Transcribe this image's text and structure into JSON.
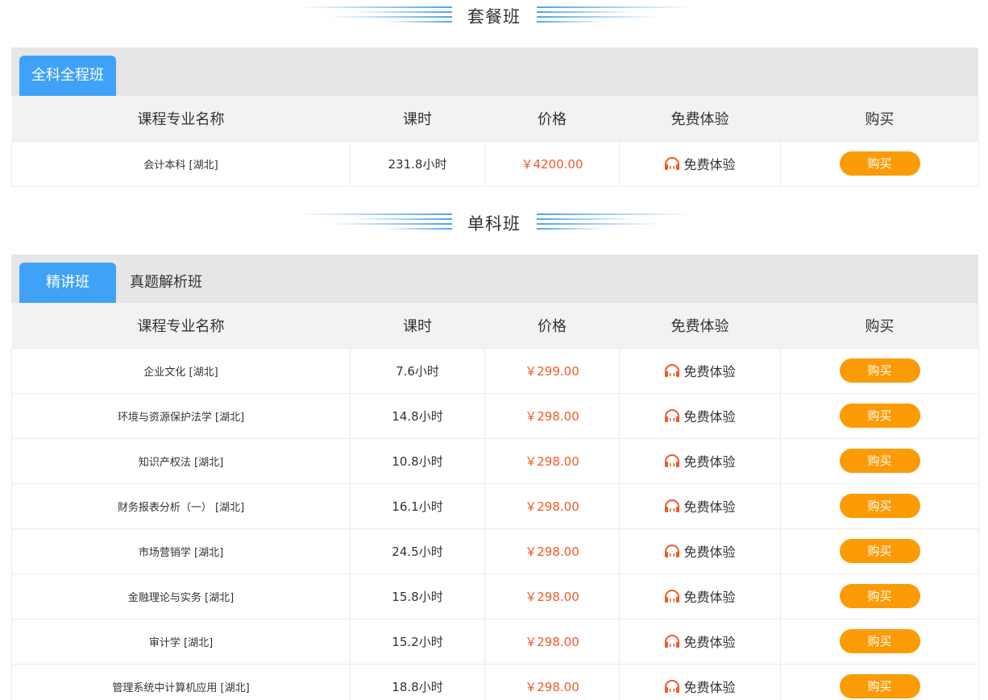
{
  "package_section": {
    "title": "套餐班",
    "tabs": [
      {
        "label": "全科全程班"
      }
    ],
    "headers": [
      "课程专业名称",
      "课时",
      "价格",
      "免费体验",
      "购买"
    ],
    "rows": [
      {
        "name": "会计本科 [湖北]",
        "hours": "231.8小时",
        "price": "￥4200.00",
        "trial": "免费体验",
        "buy": "购买"
      }
    ]
  },
  "single_section": {
    "title": "单科班",
    "tabs": [
      {
        "label": "精讲班"
      },
      {
        "label": "真题解析班"
      }
    ],
    "headers": [
      "课程专业名称",
      "课时",
      "价格",
      "免费体验",
      "购买"
    ],
    "rows": [
      {
        "name": "企业文化 [湖北]",
        "hours": "7.6小时",
        "price": "￥299.00",
        "trial": "免费体验",
        "buy": "购买"
      },
      {
        "name": "环境与资源保护法学 [湖北]",
        "hours": "14.8小时",
        "price": "￥298.00",
        "trial": "免费体验",
        "buy": "购买"
      },
      {
        "name": "知识产权法 [湖北]",
        "hours": "10.8小时",
        "price": "￥298.00",
        "trial": "免费体验",
        "buy": "购买"
      },
      {
        "name": "财务报表分析（一） [湖北]",
        "hours": "16.1小时",
        "price": "￥298.00",
        "trial": "免费体验",
        "buy": "购买"
      },
      {
        "name": "市场营销学 [湖北]",
        "hours": "24.5小时",
        "price": "￥298.00",
        "trial": "免费体验",
        "buy": "购买"
      },
      {
        "name": "金融理论与实务 [湖北]",
        "hours": "15.8小时",
        "price": "￥298.00",
        "trial": "免费体验",
        "buy": "购买"
      },
      {
        "name": "审计学 [湖北]",
        "hours": "15.2小时",
        "price": "￥298.00",
        "trial": "免费体验",
        "buy": "购买"
      },
      {
        "name": "管理系统中计算机应用 [湖北]",
        "hours": "18.8小时",
        "price": "￥298.00",
        "trial": "免费体验",
        "buy": "购买"
      }
    ]
  },
  "colors": {
    "tab_active": "#3fa2f7",
    "price": "#f05a28",
    "buy_button": "#fb9b05",
    "headphone_icon": "#f05a28"
  },
  "icons": {
    "trial": "headphones-icon"
  }
}
